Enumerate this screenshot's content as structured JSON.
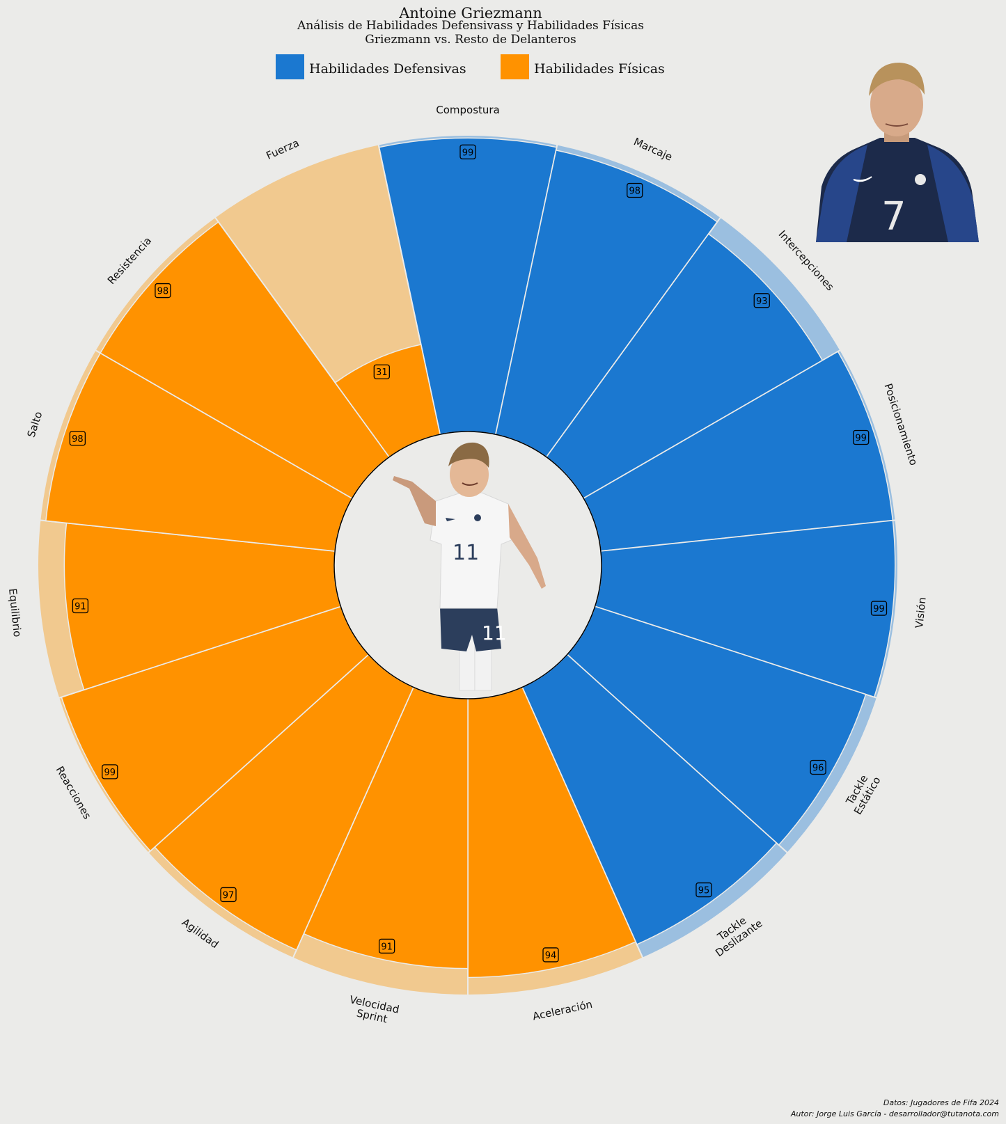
{
  "header": {
    "title": "Antoine Griezmann",
    "subtitle": "Análisis de Habilidades Defensivass y Habilidades Físicas",
    "subtitle2": "Griezmann vs. Resto de Delanteros"
  },
  "legend": [
    {
      "label": "Habilidades Defensivas",
      "color": "#1b78d0"
    },
    {
      "label": "Habilidades Físicas",
      "color": "#ff9200"
    }
  ],
  "footer": {
    "line1": "Datos: Jugadores de Fifa 2024",
    "line2": "Autor: Jorge Luis García - desarrollador@tutanota.com"
  },
  "chart_data": {
    "type": "radial-bar",
    "scale_max": 100,
    "categories": [
      {
        "label": "Compostura",
        "value": 99,
        "group": "defensive"
      },
      {
        "label": "Marcaje",
        "value": 98,
        "group": "defensive"
      },
      {
        "label": "Intercepciones",
        "value": 93,
        "group": "defensive"
      },
      {
        "label": "Posicionamiento",
        "value": 99,
        "group": "defensive"
      },
      {
        "label": "Visión",
        "value": 99,
        "group": "defensive"
      },
      {
        "label": "Tackle Estático",
        "value": 96,
        "group": "defensive"
      },
      {
        "label": "Tackle Deslizante",
        "value": 95,
        "group": "defensive"
      },
      {
        "label": "Aceleración",
        "value": 94,
        "group": "physical"
      },
      {
        "label": "Velocidad Sprint",
        "value": 91,
        "group": "physical"
      },
      {
        "label": "Agilidad",
        "value": 97,
        "group": "physical"
      },
      {
        "label": "Reacciones",
        "value": 99,
        "group": "physical"
      },
      {
        "label": "Equilibrio",
        "value": 91,
        "group": "physical"
      },
      {
        "label": "Salto",
        "value": 98,
        "group": "physical"
      },
      {
        "label": "Resistencia",
        "value": 98,
        "group": "physical"
      },
      {
        "label": "Fuerza",
        "value": 31,
        "group": "physical"
      }
    ],
    "colors": {
      "defensive": "#1b78d0",
      "defensive_light": "#9bbfe0",
      "physical": "#ff9200",
      "physical_light": "#f1c98f"
    }
  },
  "images": {
    "top_photo": "player-portrait-france-7",
    "center_photo": "player-celebration-france-11"
  }
}
